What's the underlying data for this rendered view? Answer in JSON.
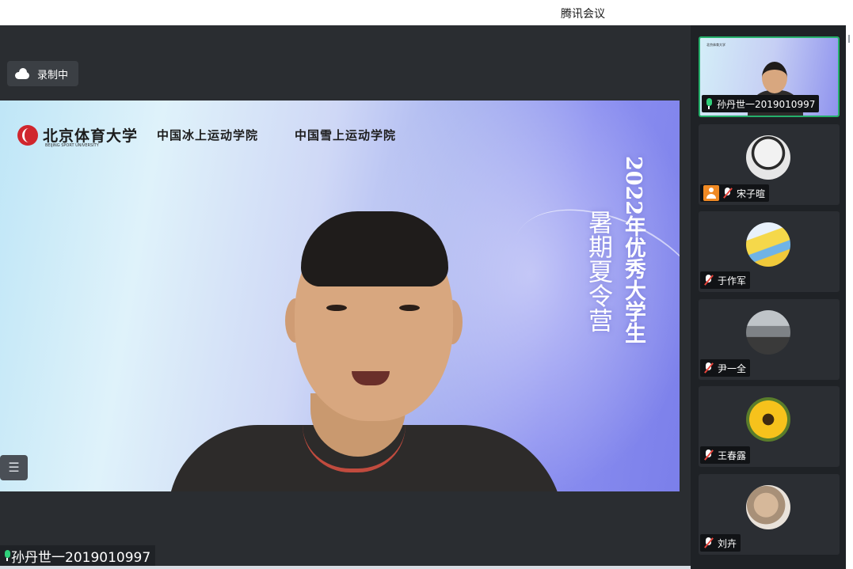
{
  "window": {
    "title": "腾讯会议"
  },
  "recording": {
    "label": "录制中"
  },
  "slide": {
    "university_name": "北京体育大学",
    "university_en": "BEIJING SPORT UNIVERSITY",
    "institute_1": "中国冰上运动学院",
    "institute_2": "中国雪上运动学院",
    "year_line": "2022年优秀大学生",
    "camp_line": "暑期夏令营"
  },
  "main_speaker": {
    "name": "孙丹世一2019010997",
    "mic": "on"
  },
  "participants": [
    {
      "name": "孙丹世一2019010997",
      "mic": "on",
      "active": true,
      "video": true
    },
    {
      "name": "宋子暄",
      "mic": "off",
      "host": true,
      "avatar_colors": [
        "#f2f2f2",
        "#d9d9d9"
      ]
    },
    {
      "name": "于作军",
      "mic": "off",
      "avatar_colors": [
        "#f5d84a",
        "#6fb3e6"
      ]
    },
    {
      "name": "尹一全",
      "mic": "off",
      "avatar_colors": [
        "#9a9a9a",
        "#3a3a3a"
      ]
    },
    {
      "name": "王春露",
      "mic": "off",
      "avatar_colors": [
        "#f6c21c",
        "#3e2a10"
      ]
    },
    {
      "name": "刘卉",
      "mic": "off",
      "avatar_colors": [
        "#d6b89a",
        "#7a6a5a"
      ]
    }
  ],
  "icons": {
    "cloud": "cloud-icon",
    "list": "list-icon",
    "mic_on": "mic-icon",
    "mic_off": "mic-muted-icon",
    "host": "host-icon"
  },
  "colors": {
    "accent_green": "#25b06b",
    "host_orange": "#f08a24",
    "muted_red": "#e8453c"
  }
}
